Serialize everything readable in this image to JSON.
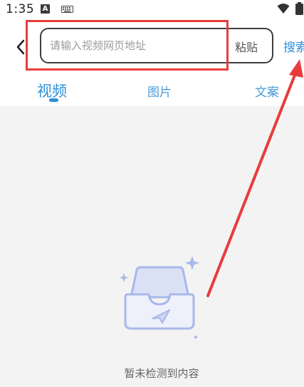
{
  "status_bar": {
    "time": "1:35",
    "a_badge": "A"
  },
  "search": {
    "placeholder": "请输入视频网页地址",
    "value": "",
    "paste_label": "粘贴",
    "search_label": "搜索"
  },
  "tabs": [
    {
      "label": "视频",
      "active": true
    },
    {
      "label": "图片",
      "active": false
    },
    {
      "label": "文案",
      "active": false
    }
  ],
  "empty_state": {
    "message": "暂未检测到内容"
  },
  "colors": {
    "accent": "#2f8fd8",
    "annotation": "#e83c3c",
    "content_bg": "#f3f3f3",
    "illustration": "#a9b7ea"
  },
  "icons": {
    "back": "chevron-left-icon",
    "wifi": "wifi-icon",
    "battery": "battery-icon",
    "keyboard": "keyboard-icon",
    "empty": "empty-inbox-icon"
  }
}
